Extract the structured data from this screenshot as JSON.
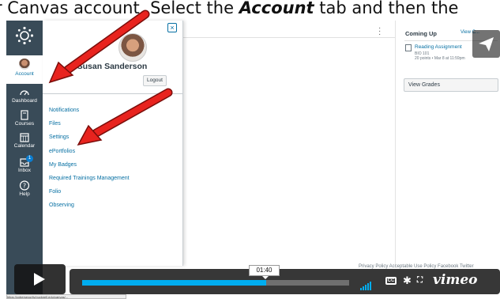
{
  "caption": {
    "part1": "r Canvas account, Select the ",
    "emph": "Account",
    "part2": " tab and then the"
  },
  "global_nav": {
    "items": [
      {
        "label": "Account",
        "icon": "avatar-icon"
      },
      {
        "label": "Dashboard",
        "icon": "dashboard-icon"
      },
      {
        "label": "Courses",
        "icon": "book-icon"
      },
      {
        "label": "Calendar",
        "icon": "calendar-icon"
      },
      {
        "label": "Inbox",
        "icon": "inbox-icon",
        "badge": "1"
      },
      {
        "label": "Help",
        "icon": "help-icon"
      }
    ]
  },
  "account_tray": {
    "close_label": "×",
    "user_name": "Susan Sanderson",
    "logout_label": "Logout",
    "links": [
      "Notifications",
      "Files",
      "Settings",
      "ePortfolios",
      "My Badges",
      "Required Trainings Management",
      "Folio",
      "Observing"
    ]
  },
  "sidebar": {
    "coming_up": "Coming Up",
    "view_calendar": "View C...",
    "assignment_title": "Reading Assignment",
    "assignment_course": "BIO 101",
    "assignment_meta": "20 points • Mar 8 at 11:59pm",
    "view_grades": "View Grades"
  },
  "footer": {
    "text": "Privacy Policy   Acceptable Use Policy   Facebook   Twitter"
  },
  "video": {
    "timestamp": "01:40",
    "progress": 0.69,
    "cc_label": "CC",
    "brand": "vimeo",
    "accent_color": "#00adef"
  },
  "status_url": "https://cybersecurity.bucknell.edu/canvas/...",
  "colors": {
    "annotation_arrow": "#e8231e",
    "nav_bg": "#394b58",
    "link": "#0770a3"
  }
}
